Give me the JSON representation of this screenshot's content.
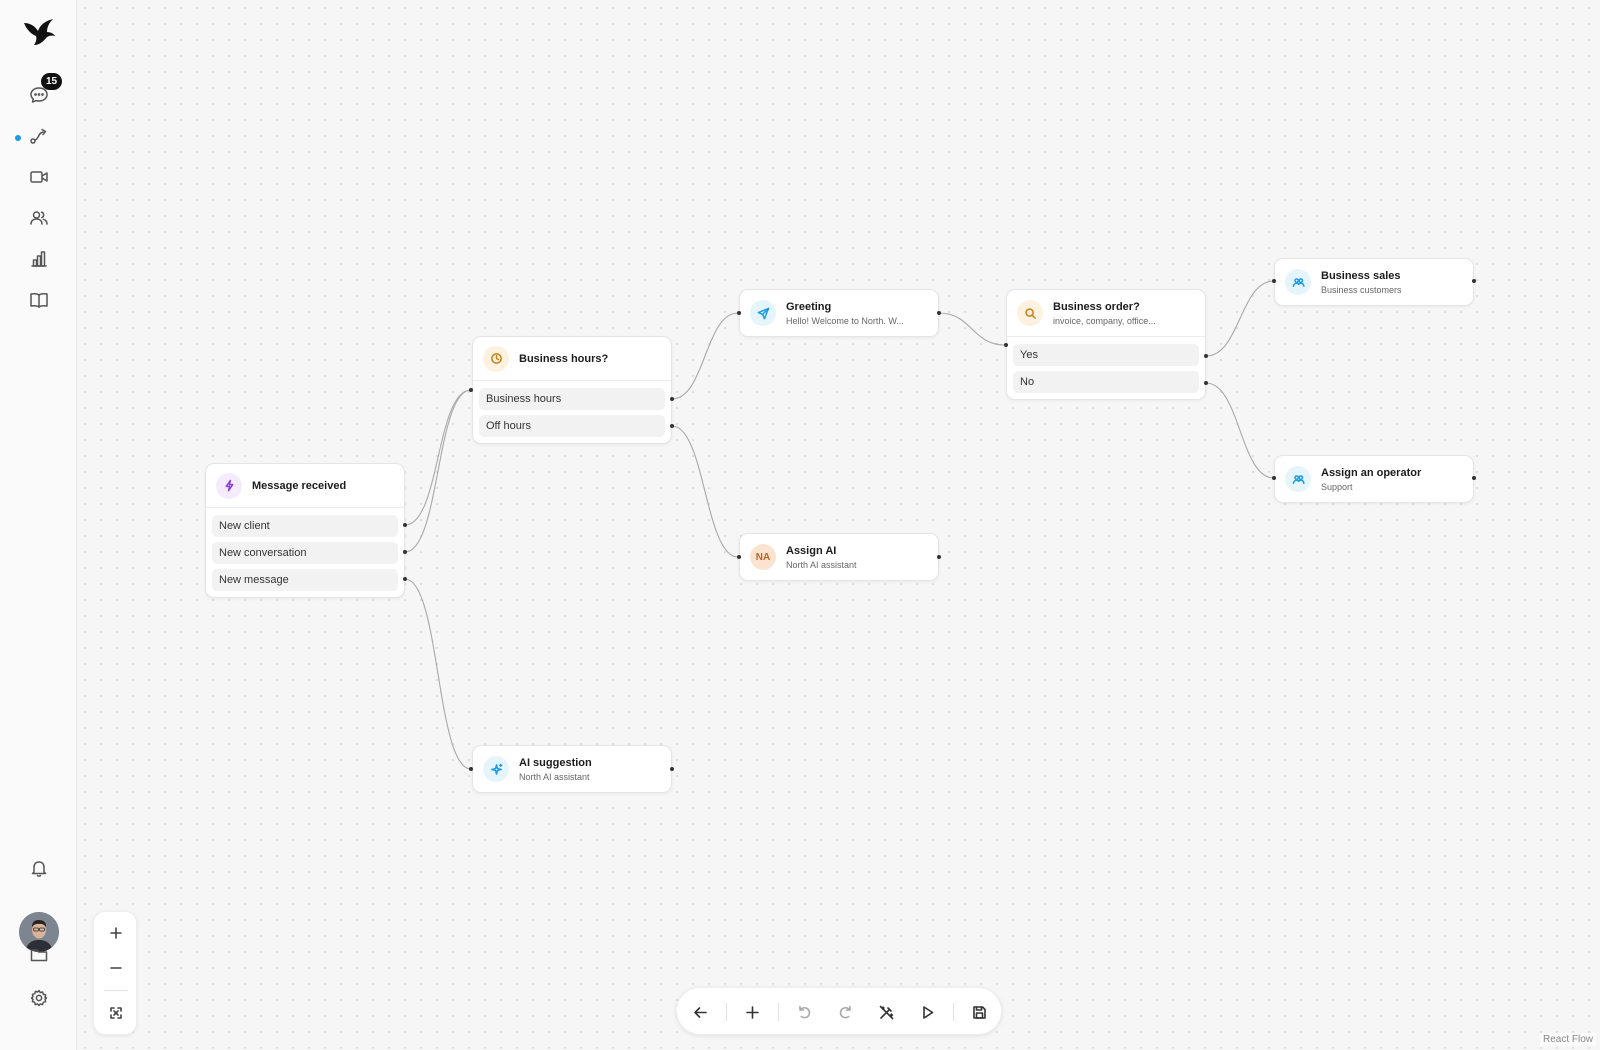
{
  "sidebar": {
    "logo": "bird-logo",
    "chat_badge": "15",
    "items": [
      {
        "name": "chat-icon"
      },
      {
        "name": "flow-icon",
        "active": true
      },
      {
        "name": "video-icon"
      },
      {
        "name": "users-icon"
      },
      {
        "name": "chart-icon"
      },
      {
        "name": "book-icon"
      }
    ],
    "bottom": [
      {
        "name": "bell-icon"
      },
      {
        "name": "avatar"
      },
      {
        "name": "folder-icon"
      },
      {
        "name": "gear-icon"
      }
    ],
    "accent_color": "#1a9be6"
  },
  "nodes": {
    "message_received": {
      "title": "Message received",
      "options": [
        "New client",
        "New conversation",
        "New message"
      ]
    },
    "business_hours": {
      "title": "Business hours?",
      "options": [
        "Business hours",
        "Off hours"
      ]
    },
    "greeting": {
      "title": "Greeting",
      "subtitle": "Hello! Welcome to North. W..."
    },
    "assign_ai": {
      "title": "Assign AI",
      "subtitle": "North AI assistant",
      "initials": "NA"
    },
    "ai_suggestion": {
      "title": "AI suggestion",
      "subtitle": "North AI assistant"
    },
    "business_order": {
      "title": "Business order?",
      "subtitle": "invoice, company, office...",
      "options": [
        "Yes",
        "No"
      ]
    },
    "business_sales": {
      "title": "Business sales",
      "subtitle": "Business customers"
    },
    "assign_operator": {
      "title": "Assign an operator",
      "subtitle": "Support"
    }
  },
  "zoom_controls": [
    "zoom-in",
    "zoom-out",
    "fit-view"
  ],
  "toolbar": [
    "back",
    "add",
    "undo",
    "redo",
    "magic",
    "play",
    "save"
  ],
  "attribution": "React Flow"
}
